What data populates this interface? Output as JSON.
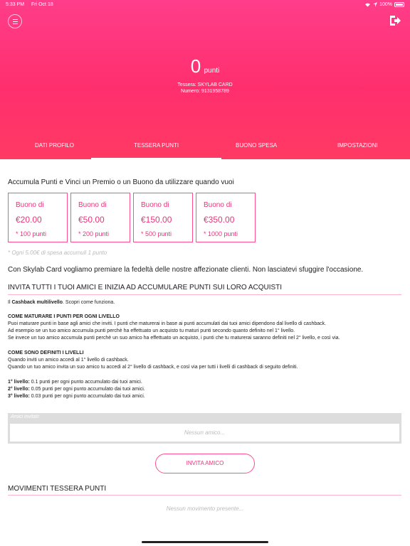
{
  "status": {
    "time": "5:33 PM",
    "date": "Fri Oct 18",
    "battery": "100%"
  },
  "header": {
    "points_value": "0",
    "points_unit": "punti",
    "card_line": "Tessera: SKYLAB CARD",
    "number_line": "Numero: 9131958789"
  },
  "tabs": [
    "DATI PROFILO",
    "TESSERA PUNTI",
    "BUONO SPESA",
    "IMPOSTAZIONI"
  ],
  "active_tab": "TESSERA PUNTI",
  "intro": "Accumula Punti e Vinci un Premio o un Buono da utilizzare quando vuoi",
  "vouchers": [
    {
      "title": "Buono di",
      "amount": "€20.00",
      "points": "* 100 punti"
    },
    {
      "title": "Buono di",
      "amount": "€50.00",
      "points": "* 200 punti"
    },
    {
      "title": "Buono di",
      "amount": "€150.00",
      "points": "* 500 punti"
    },
    {
      "title": "Buono di",
      "amount": "€350.00",
      "points": "* 1000 punti"
    }
  ],
  "note": "* Ogni 5.00€ di spesa accumuli 1 punto",
  "loyalty": "Con Skylab Card vogliamo premiare la fedeltà delle nostre affezionate clienti. Non lasciatevi sfuggire l'occasione.",
  "invite_title": "INVITA TUTTI I TUOI AMICI E INIZIA AD ACCUMULARE PUNTI SUI LORO ACQUISTI",
  "cashback": {
    "prefix": "Il ",
    "bold": "Cashback multilivello",
    "suffix": ". Scopri come funziona."
  },
  "how_title": "COME MATURARE I PUNTI PER OGNI LIVELLO",
  "how_lines": [
    "Puoi maturare punti in base agli amici che inviti. I punti che maturerai in base ai punti accumulati dai tuoi amici dipendono dal livello di cashback.",
    "Ad esempio se un tuo amico accumula punti perchè ha effettuato un acquisto tu maturi punti secondo quanto definito nel 1° livello.",
    "Se invece un tuo amico accumula punti perchè un suo amico ha effettuato un acquisto, i punti che tu maturerai saranno definiti nel 2° livello, e così via."
  ],
  "levels_title": "COME SONO DEFINITI I LIVELLI",
  "levels_lines": [
    "Quando inviti un amico accedi al 1° livello di cashback.",
    "Quando un tuo amico invita un suo amico tu accedi al 2° livello di cashback, e così via per tutti i livelli di cashback di seguito definiti."
  ],
  "level_values": [
    {
      "label": "1° livello:",
      "text": " 0.1 punti per ogni punto accumulato dai tuoi amici."
    },
    {
      "label": "2° livello:",
      "text": " 0.05 punti per ogni punto accumulato dai tuoi amici."
    },
    {
      "label": "3° livello:",
      "text": " 0.03 punti per ogni punto accumulato dai tuoi amici."
    }
  ],
  "friends_label": "Amici invitati:",
  "friends_empty": "Nessun amico...",
  "invite_button": "INVITA AMICO",
  "movements_title": "MOVIMENTI TESSERA PUNTI",
  "movements_empty": "Nessun movimento presente..."
}
